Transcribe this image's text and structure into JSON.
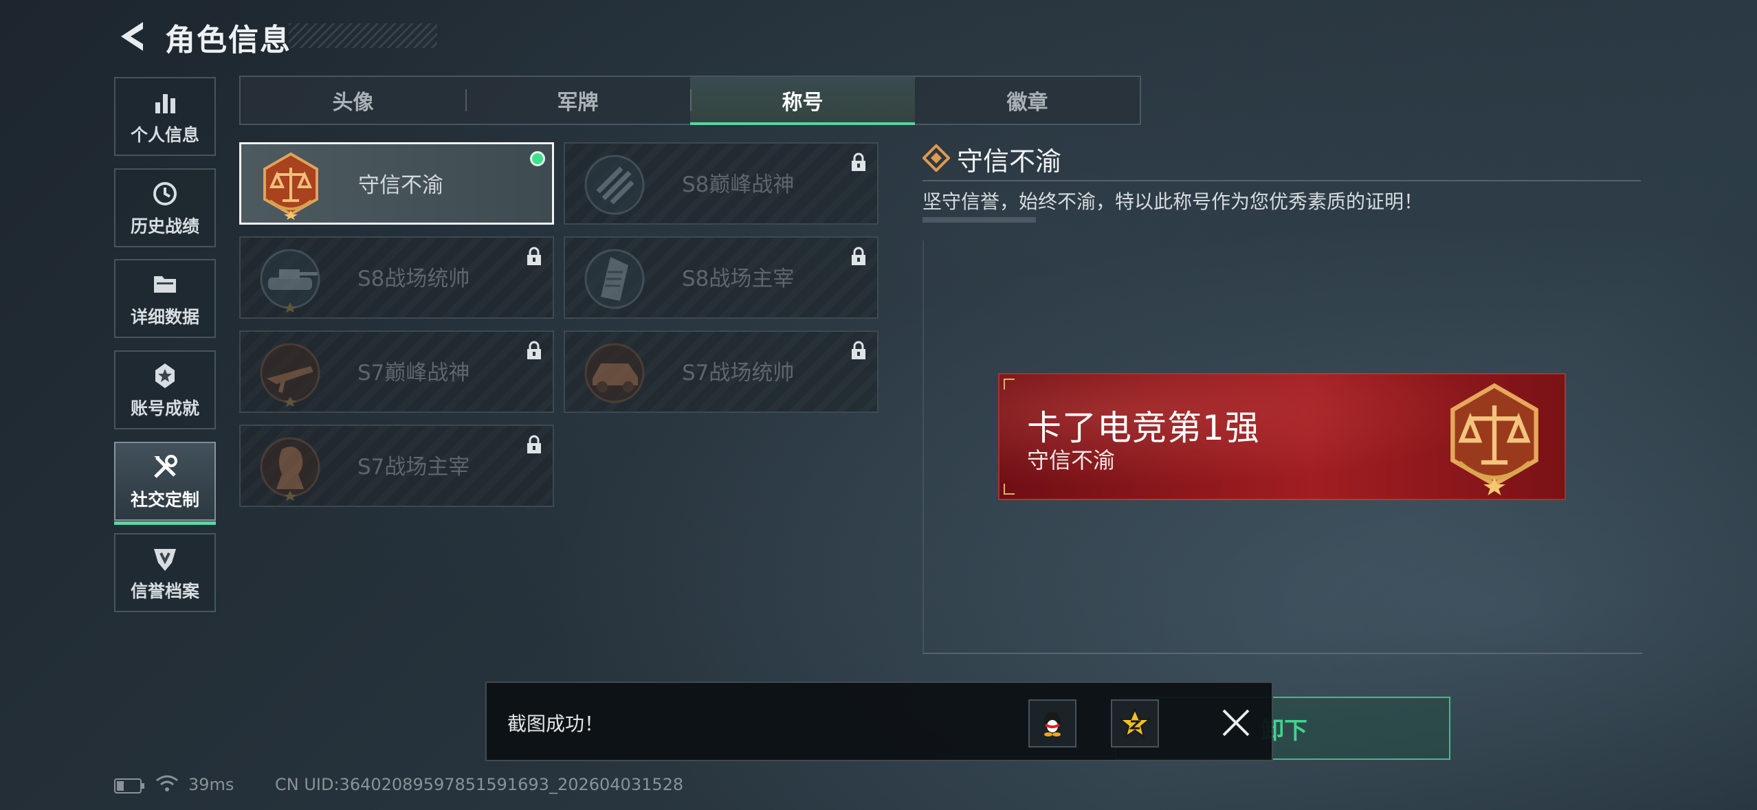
{
  "header": {
    "title": "角色信息"
  },
  "nav": {
    "items": [
      {
        "label": "个人信息",
        "icon": "bar-chart-icon"
      },
      {
        "label": "历史战绩",
        "icon": "clock-history-icon"
      },
      {
        "label": "详细数据",
        "icon": "folder-icon"
      },
      {
        "label": "账号成就",
        "icon": "achievement-icon"
      },
      {
        "label": "社交定制",
        "icon": "tools-icon",
        "active": true
      },
      {
        "label": "信誉档案",
        "icon": "shield-badge-icon"
      }
    ]
  },
  "tabs": [
    {
      "label": "头像"
    },
    {
      "label": "军牌"
    },
    {
      "label": "称号",
      "active": true
    },
    {
      "label": "徽章"
    }
  ],
  "titles": [
    {
      "label": "守信不渝",
      "locked": false,
      "equipped": true,
      "emblem": "scales-emblem-icon"
    },
    {
      "label": "S8巅峰战神",
      "locked": true,
      "emblem": "rank-emblem-icon"
    },
    {
      "label": "S8战场统帅",
      "locked": true,
      "emblem": "tank-emblem-icon"
    },
    {
      "label": "S8战场主宰",
      "locked": true,
      "emblem": "building-emblem-icon"
    },
    {
      "label": "S7巅峰战神",
      "locked": true,
      "emblem": "rifle-emblem-icon"
    },
    {
      "label": "S7战场统帅",
      "locked": true,
      "emblem": "vehicle-emblem-icon"
    },
    {
      "label": "S7战场主宰",
      "locked": true,
      "emblem": "soldier-emblem-icon"
    }
  ],
  "detail": {
    "title": "守信不渝",
    "description": "坚守信誉，始终不渝，特以此称号作为您优秀素质的证明！"
  },
  "banner": {
    "player_name": "卡了电竞第1强",
    "title": "守信不渝"
  },
  "unequip_button": {
    "label": "卸下"
  },
  "toast": {
    "message": "截图成功！",
    "actions": [
      "qq-share-icon",
      "qzone-share-icon"
    ]
  },
  "status": {
    "ping": "39ms",
    "uid": "CN UID:3640208959785159​1693_202604031528"
  },
  "colors": {
    "accent": "#58d49d",
    "banner_red": "#a11e22",
    "emblem_gold": "#d79a4a"
  }
}
